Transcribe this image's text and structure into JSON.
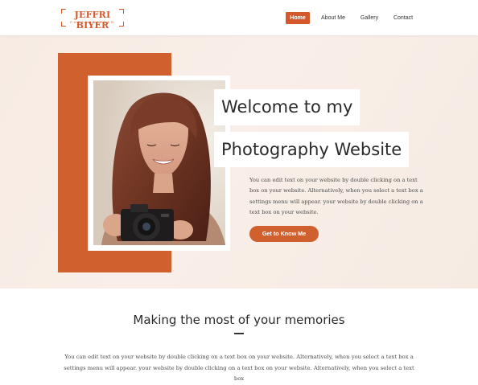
{
  "logo": {
    "name": "JEFFRI BIYER",
    "subtitle": "PHOTOGRAPHER"
  },
  "nav": {
    "items": [
      {
        "label": "Home",
        "active": true
      },
      {
        "label": "About Me",
        "active": false
      },
      {
        "label": "Gallery",
        "active": false
      },
      {
        "label": "Contact",
        "active": false
      }
    ]
  },
  "hero": {
    "title_line1": "Welcome to my",
    "title_line2": "Photography Website",
    "body": "You can edit text on your website by double clicking on a text box on your website. Alternatively, when you select a text box a settings menu will appear. your website by double clicking on a text box on your website.",
    "cta_label": "Get to Know Me",
    "photo_icon": "woman-with-camera-photo"
  },
  "section": {
    "title": "Making the most of your memories",
    "body": "You can edit text on your website by double clicking on a text box on your website. Alternatively, when you select a text box a settings menu will appear. your website by double clicking on a text box on your website. Alternatively, when you select a text box"
  },
  "colors": {
    "accent": "#d1602f",
    "hero_bg": "#f7ebe3",
    "text": "#3a3a3a"
  }
}
